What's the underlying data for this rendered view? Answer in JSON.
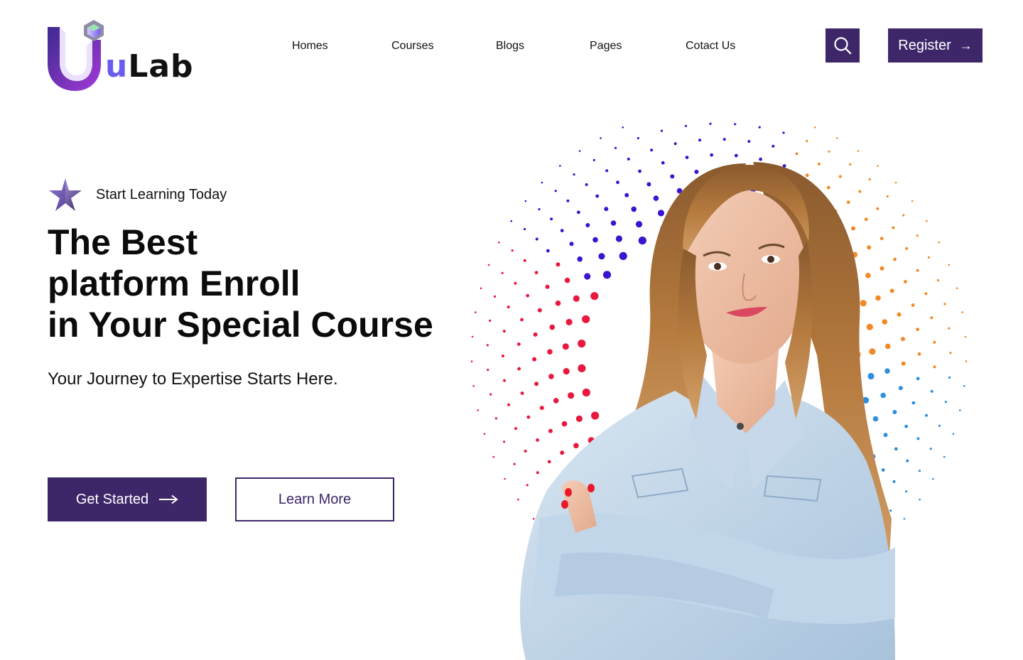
{
  "brand": {
    "name_prefix": "u",
    "name_suffix": "Lab",
    "colors": {
      "primary": "#3e2769",
      "accent": "#6b5cf0",
      "logo_gradient_start": "#3d2a8f",
      "logo_gradient_end": "#a33ad8"
    }
  },
  "nav": {
    "items": [
      "Homes",
      "Courses",
      "Blogs",
      "Pages",
      "Cotact Us"
    ]
  },
  "header": {
    "search_icon": "search-icon",
    "register_label": "Register",
    "register_arrow": "→"
  },
  "hero": {
    "tagline_icon": "star-icon",
    "tagline": "Start Learning Today",
    "headline_lines": [
      "The Best",
      "platform Enroll",
      "in Your Special Course"
    ],
    "subheadline": "Your Journey to Expertise Starts Here.",
    "primary_cta": "Get Started",
    "primary_cta_arrow": "⟶",
    "secondary_cta": "Learn More",
    "image_subject": "smiling-student-photo",
    "dot_colors": [
      "#e8193e",
      "#f08a26",
      "#2f8fdc",
      "#3a14d0",
      "#1a1a2e"
    ]
  }
}
